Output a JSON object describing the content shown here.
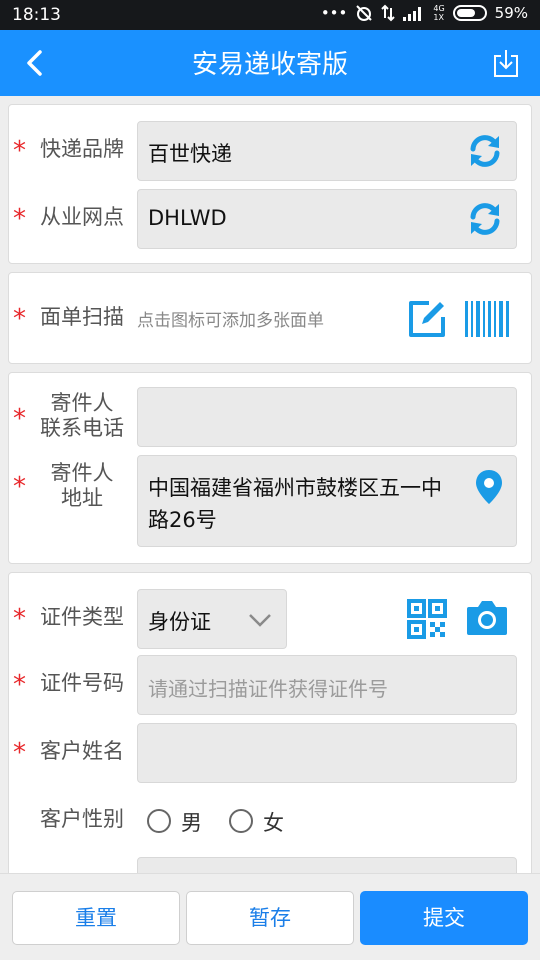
{
  "status_bar": {
    "time": "18:13",
    "network_label": "4G",
    "network_sub": "1X",
    "battery": "59%"
  },
  "app_bar": {
    "title": "安易递收寄版"
  },
  "required_mark": "*",
  "card_courier": {
    "brand_label": "快递品牌",
    "brand_value": "百世快递",
    "outlet_label": "从业网点",
    "outlet_value": "DHLWD"
  },
  "card_waybill": {
    "label": "面单扫描",
    "hint": "点击图标可添加多张面单"
  },
  "card_sender": {
    "phone_label_line1": "寄件人",
    "phone_label_line2": "联系电话",
    "phone_value": "",
    "address_label_line1": "寄件人",
    "address_label_line2": "地址",
    "address_value_line1": "中国福建省福州市鼓楼区五一中",
    "address_value_line2": "路26号"
  },
  "card_customer": {
    "id_type_label": "证件类型",
    "id_type_value": "身份证",
    "id_number_label": "证件号码",
    "id_number_placeholder": "请通过扫描证件获得证件号",
    "name_label": "客户姓名",
    "name_value": "",
    "gender_label": "客户性别",
    "gender_options": [
      "男",
      "女"
    ]
  },
  "actions": {
    "reset": "重置",
    "save_draft": "暂存",
    "submit": "提交"
  },
  "colors": {
    "accent": "#1a91ff",
    "required": "#e8282b",
    "icon_blue": "#1a9be6"
  }
}
